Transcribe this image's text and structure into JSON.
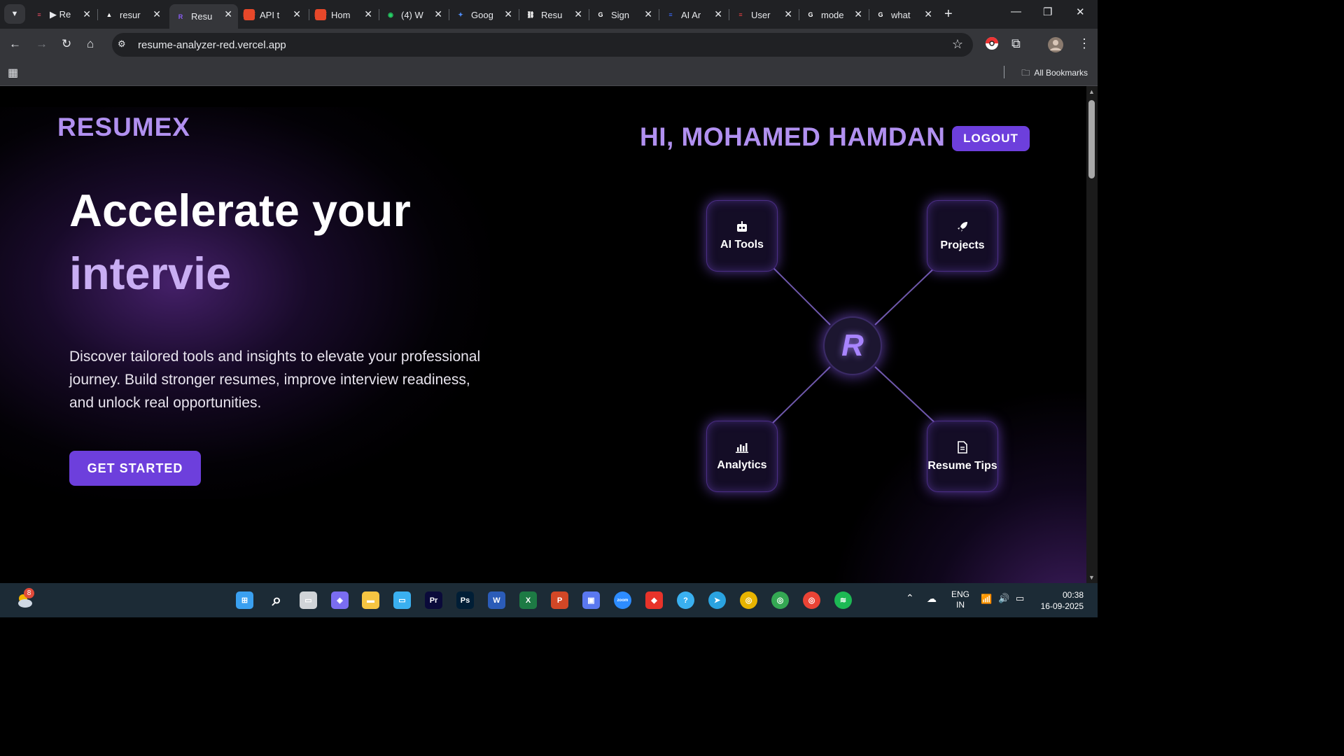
{
  "browser": {
    "tabs": [
      {
        "title": "▶ Re",
        "favicon": "pulse-icon",
        "color": "#e04a5f"
      },
      {
        "title": "resur",
        "favicon": "vercel-icon",
        "color": "#ffffff"
      },
      {
        "title": "Resu",
        "favicon": "resumex-icon",
        "color": "#8b5cf6"
      },
      {
        "title": "API t",
        "favicon": "pdf-icon",
        "color": "#e8482a"
      },
      {
        "title": "Hom",
        "favicon": "pdf-icon",
        "color": "#e8482a"
      },
      {
        "title": "(4) W",
        "favicon": "whatsapp-icon",
        "color": "#25d366"
      },
      {
        "title": "Goog",
        "favicon": "gemini-icon",
        "color": "#4f8cf7"
      },
      {
        "title": "Resu",
        "favicon": "link-icon",
        "color": "#ffffff"
      },
      {
        "title": "Sign",
        "favicon": "google-icon",
        "color": "#ffffff"
      },
      {
        "title": "AI Ar",
        "favicon": "ai-icon",
        "color": "#3b6cff"
      },
      {
        "title": "User",
        "favicon": "ai-icon",
        "color": "#e54040"
      },
      {
        "title": "mode",
        "favicon": "google-icon",
        "color": "#ffffff"
      },
      {
        "title": "what",
        "favicon": "google-icon",
        "color": "#ffffff"
      }
    ],
    "url": "resume-analyzer-red.vercel.app",
    "bookmarks_label": "All Bookmarks"
  },
  "app": {
    "brand": "RESUMEX",
    "greeting": "HI, MOHAMED HAMDAN",
    "logout_label": "LOGOUT",
    "headline_line1": "Accelerate your",
    "headline_line2": "intervie",
    "description": "Discover tailored tools and insights to elevate your professional journey. Build stronger resumes, improve interview readiness, and unlock real opportunities.",
    "cta_label": "GET STARTED",
    "network": {
      "hub_label": "R",
      "nodes": [
        {
          "label": "AI Tools",
          "icon": "robot-icon"
        },
        {
          "label": "Projects",
          "icon": "rocket-icon"
        },
        {
          "label": "Analytics",
          "icon": "chart-icon"
        },
        {
          "label": "Resume Tips",
          "icon": "document-icon"
        }
      ]
    },
    "colors": {
      "accent": "#6d3fdc",
      "brand_text": "#b190f0",
      "headline_accent": "#c9aef3"
    }
  },
  "taskbar": {
    "weather_badge": "8",
    "language": "ENG",
    "region": "IN",
    "time": "00:38",
    "date": "16-09-2025"
  }
}
